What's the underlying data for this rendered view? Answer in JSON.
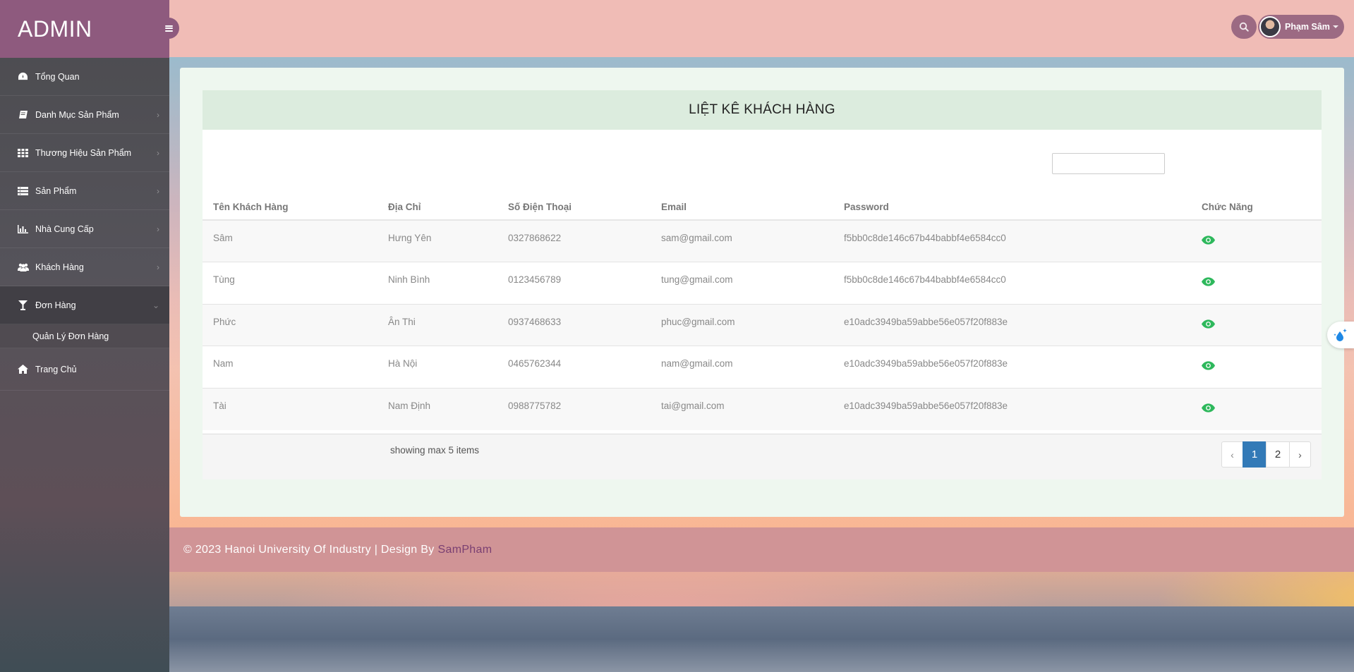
{
  "sidebar": {
    "brand": "ADMIN",
    "items": [
      {
        "label": "Tổng Quan",
        "icon": "dashboard-icon"
      },
      {
        "label": "Danh Mục Sản Phẩm",
        "icon": "book-icon"
      },
      {
        "label": "Thương Hiệu Sản Phẩm",
        "icon": "grid-icon"
      },
      {
        "label": "Sản Phẩm",
        "icon": "list-icon"
      },
      {
        "label": "Nhà Cung Cấp",
        "icon": "bar-chart-icon"
      },
      {
        "label": "Khách Hàng",
        "icon": "users-icon"
      },
      {
        "label": "Đơn Hàng",
        "icon": "glass-icon"
      }
    ],
    "sub_item": "Quản Lý Đơn Hàng",
    "home": "Trang Chủ"
  },
  "header": {
    "user_name": "Phạm Sâm"
  },
  "main": {
    "title": "LIỆT KÊ KHÁCH HÀNG",
    "filter_placeholder": "",
    "columns": [
      "Tên Khách Hàng",
      "Địa Chỉ",
      "Số Điện Thoại",
      "Email",
      "Password",
      "Chức Năng"
    ],
    "rows": [
      {
        "name": "Sâm",
        "address": "Hưng Yên",
        "phone": "0327868622",
        "email": "sam@gmail.com",
        "password": "f5bb0c8de146c67b44babbf4e6584cc0"
      },
      {
        "name": "Tùng",
        "address": "Ninh Bình",
        "phone": "0123456789",
        "email": "tung@gmail.com",
        "password": "f5bb0c8de146c67b44babbf4e6584cc0"
      },
      {
        "name": "Phức",
        "address": "Ân Thi",
        "phone": "0937468633",
        "email": "phuc@gmail.com",
        "password": "e10adc3949ba59abbe56e057f20f883e"
      },
      {
        "name": "Nam",
        "address": "Hà Nội",
        "phone": "0465762344",
        "email": "nam@gmail.com",
        "password": "e10adc3949ba59abbe56e057f20f883e"
      },
      {
        "name": "Tài",
        "address": "Nam Định",
        "phone": "0988775782",
        "email": "tai@gmail.com",
        "password": "e10adc3949ba59abbe56e057f20f883e"
      }
    ],
    "showing": "showing max 5 items",
    "pagination": {
      "prev": "‹",
      "pages": [
        "1",
        "2"
      ],
      "next": "›",
      "current": "1"
    }
  },
  "footer": {
    "text": "© 2023 Hanoi University Of Industry | Design By",
    "link": "SamPham"
  },
  "colors": {
    "brand": "#8e5a7e",
    "header": "#f0bcb6",
    "footer": "#d09496",
    "eye": "#2eb85c",
    "page_active": "#337ab7"
  }
}
